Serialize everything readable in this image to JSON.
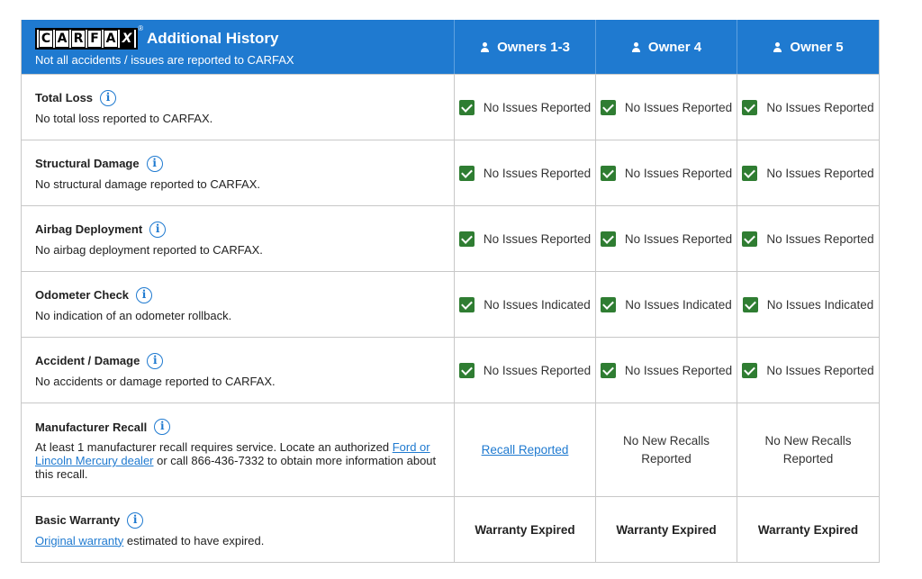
{
  "header": {
    "logo_letters": [
      "C",
      "A",
      "R",
      "F",
      "A",
      "X"
    ],
    "logo_reg": "®",
    "title": "Additional History",
    "subtitle": "Not all accidents / issues are reported to CARFAX",
    "owners": [
      "Owners 1-3",
      "Owner 4",
      "Owner 5"
    ]
  },
  "rows": [
    {
      "title": "Total Loss",
      "desc": "No total loss reported to CARFAX.",
      "status": [
        "No Issues Reported",
        "No Issues Reported",
        "No Issues Reported"
      ]
    },
    {
      "title": "Structural Damage",
      "desc": "No structural damage reported to CARFAX.",
      "status": [
        "No Issues Reported",
        "No Issues Reported",
        "No Issues Reported"
      ]
    },
    {
      "title": "Airbag Deployment",
      "desc": "No airbag deployment reported to CARFAX.",
      "status": [
        "No Issues Reported",
        "No Issues Reported",
        "No Issues Reported"
      ]
    },
    {
      "title": "Odometer Check",
      "desc": "No indication of an odometer rollback.",
      "status": [
        "No Issues Indicated",
        "No Issues Indicated",
        "No Issues Indicated"
      ]
    },
    {
      "title": "Accident / Damage",
      "desc": "No accidents or damage reported to CARFAX.",
      "status": [
        "No Issues Reported",
        "No Issues Reported",
        "No Issues Reported"
      ]
    }
  ],
  "recall": {
    "title": "Manufacturer Recall",
    "desc_before": "At least 1 manufacturer recall requires service. Locate an authorized ",
    "desc_link": "Ford or Lincoln Mercury dealer",
    "desc_after": " or call 866-436-7332 to obtain more information about this recall.",
    "status": [
      "Recall Reported",
      "No New Recalls Reported",
      "No New Recalls Reported"
    ]
  },
  "warranty": {
    "title": "Basic Warranty",
    "desc_link": "Original warranty",
    "desc_after": " estimated to have expired.",
    "status": [
      "Warranty Expired",
      "Warranty Expired",
      "Warranty Expired"
    ]
  },
  "colors": {
    "header_bg": "#1f7ad0",
    "check": "#2f7d32",
    "link": "#1f7ad0"
  },
  "icons": {
    "info": "info-circle-icon",
    "check": "checkbox-checked-icon",
    "owner": "person-icon"
  }
}
